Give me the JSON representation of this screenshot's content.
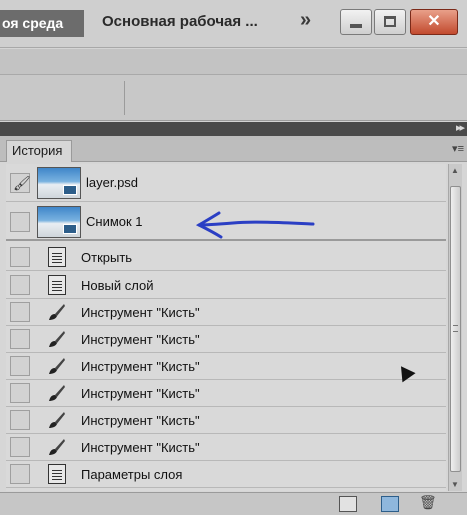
{
  "titlebar": {
    "workspace_label": "оя среда",
    "document_title": "Основная рабочая ...",
    "overflow": "»",
    "close_glyph": "✕"
  },
  "panel": {
    "tab_label": "История",
    "collapse_arrows": "▸▸",
    "menu_glyph": "▾≡"
  },
  "snapshots": [
    {
      "label": "layer.psd",
      "source_marker": "🖌"
    },
    {
      "label": "Снимок 1"
    }
  ],
  "steps": [
    {
      "label": "Открыть",
      "icon": "document-icon"
    },
    {
      "label": "Новый слой",
      "icon": "document-icon"
    },
    {
      "label": "Инструмент \"Кисть\"",
      "icon": "brush-icon"
    },
    {
      "label": "Инструмент \"Кисть\"",
      "icon": "brush-icon"
    },
    {
      "label": "Инструмент \"Кисть\"",
      "icon": "brush-icon"
    },
    {
      "label": "Инструмент \"Кисть\"",
      "icon": "brush-icon"
    },
    {
      "label": "Инструмент \"Кисть\"",
      "icon": "brush-icon"
    },
    {
      "label": "Инструмент \"Кисть\"",
      "icon": "brush-icon"
    },
    {
      "label": "Параметры слоя",
      "icon": "document-icon"
    }
  ],
  "footer": {
    "trash_glyph": "🗑"
  },
  "colors": {
    "annotation": "#2b3fc4",
    "close_button": "#c24a2e",
    "workspace_button": "#6c6c6c"
  }
}
